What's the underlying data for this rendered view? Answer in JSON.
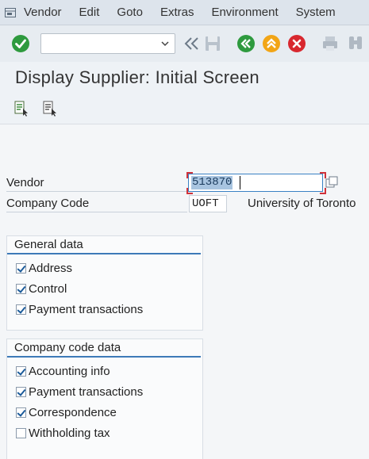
{
  "menu": {
    "items": [
      "Vendor",
      "Edit",
      "Goto",
      "Extras",
      "Environment",
      "System"
    ]
  },
  "toolbar": {
    "command_value": "",
    "icons": [
      "enter-icon",
      "back-icon",
      "save-icon",
      "back-arrow-icon",
      "exit-icon",
      "cancel-icon",
      "print-icon",
      "find-icon"
    ]
  },
  "page": {
    "title": "Display Supplier:  Initial Screen"
  },
  "fields": {
    "vendor_label": "Vendor",
    "vendor_value": "513870",
    "company_code_label": "Company Code",
    "company_code_value": "UOFT",
    "company_code_text": "University of Toronto"
  },
  "general_data": {
    "title": "General data",
    "items": [
      {
        "label": "Address",
        "checked": true
      },
      {
        "label": "Control",
        "checked": true
      },
      {
        "label": "Payment transactions",
        "checked": true
      }
    ]
  },
  "company_code_data": {
    "title": "Company code data",
    "items": [
      {
        "label": "Accounting info",
        "checked": true
      },
      {
        "label": "Payment transactions",
        "checked": true
      },
      {
        "label": "Correspondence",
        "checked": true
      },
      {
        "label": "Withholding tax",
        "checked": false
      }
    ]
  }
}
